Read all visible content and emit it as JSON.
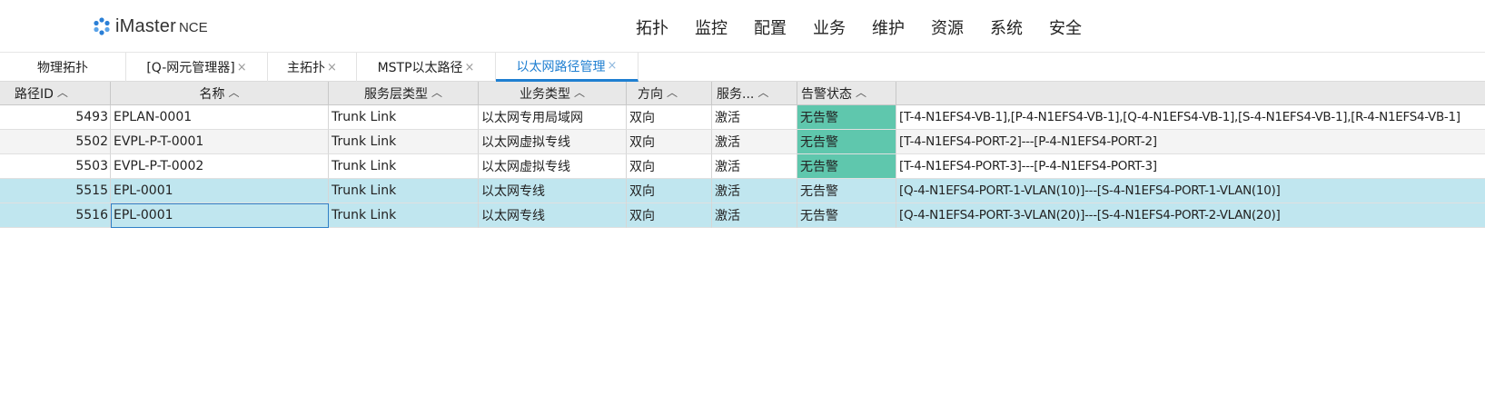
{
  "header": {
    "brand": "iMaster",
    "brand_suffix": "NCE",
    "nav": [
      "拓扑",
      "监控",
      "配置",
      "业务",
      "维护",
      "资源",
      "系统",
      "安全"
    ]
  },
  "tabs": [
    {
      "label": "物理拓扑",
      "closable": false,
      "active": false
    },
    {
      "label": "[Q-网元管理器]",
      "closable": true,
      "active": false
    },
    {
      "label": "主拓扑",
      "closable": true,
      "active": false
    },
    {
      "label": "MSTP以太路径",
      "closable": true,
      "active": false
    },
    {
      "label": "以太网路径管理",
      "closable": true,
      "active": true
    }
  ],
  "close_glyph": "×",
  "sort_glyph": "︿",
  "table": {
    "columns": [
      "路径ID",
      "名称",
      "服务层类型",
      "业务类型",
      "方向",
      "服务...",
      "告警状态",
      ""
    ],
    "rows": [
      [
        "5493",
        "EPLAN-0001",
        "Trunk Link",
        "以太网专用局域网",
        "双向",
        "激活",
        "无告警",
        "[T-4-N1EFS4-VB-1],[P-4-N1EFS4-VB-1],[Q-4-N1EFS4-VB-1],[S-4-N1EFS4-VB-1],[R-4-N1EFS4-VB-1]"
      ],
      [
        "5502",
        "EVPL-P-T-0001",
        "Trunk Link",
        "以太网虚拟专线",
        "双向",
        "激活",
        "无告警",
        "[T-4-N1EFS4-PORT-2]---[P-4-N1EFS4-PORT-2]"
      ],
      [
        "5503",
        "EVPL-P-T-0002",
        "Trunk Link",
        "以太网虚拟专线",
        "双向",
        "激活",
        "无告警",
        "[T-4-N1EFS4-PORT-3]---[P-4-N1EFS4-PORT-3]"
      ],
      [
        "5515",
        "EPL-0001",
        "Trunk Link",
        "以太网专线",
        "双向",
        "激活",
        "无告警",
        "[Q-4-N1EFS4-PORT-1-VLAN(10)]---[S-4-N1EFS4-PORT-1-VLAN(10)]"
      ],
      [
        "5516",
        "EPL-0001",
        "Trunk Link",
        "以太网专线",
        "双向",
        "激活",
        "无告警",
        "[Q-4-N1EFS4-PORT-3-VLAN(20)]---[S-4-N1EFS4-PORT-2-VLAN(20)]"
      ]
    ],
    "selected_rows": [
      3,
      4
    ],
    "alarm_highlight_rows": [
      0,
      1,
      2
    ],
    "alarm_color": "#5fc7ad",
    "selection_color": "#c0e6ef"
  },
  "colors": {
    "accent": "#1f7fd1",
    "logo_blue": "#2b7fd6"
  }
}
